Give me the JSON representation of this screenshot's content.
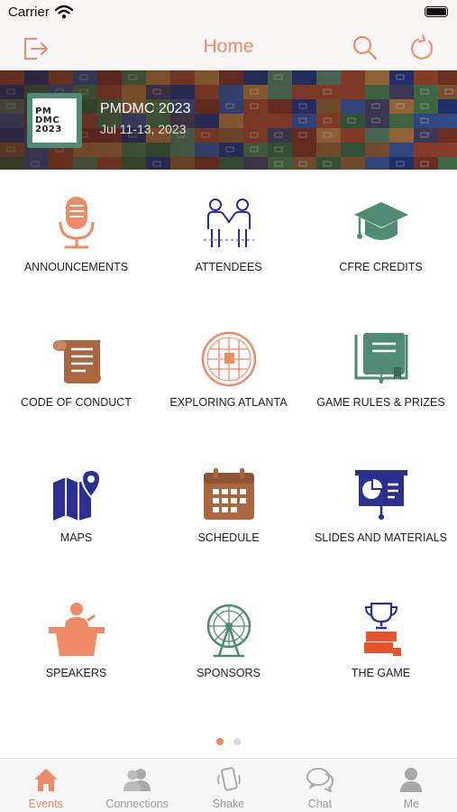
{
  "status_bar": {
    "carrier": "Carrier"
  },
  "nav": {
    "title": "Home"
  },
  "colors": {
    "accent": "#ef8a66",
    "green": "#4f8b72",
    "navy": "#2b2f8f",
    "brown": "#a9663f"
  },
  "banner": {
    "title": "PMDMC 2023",
    "date": "Jul 11-13, 2023",
    "logo_lines": [
      "PM",
      "DMC",
      "2023"
    ]
  },
  "tiles": [
    {
      "label": "ANNOUNCEMENTS",
      "icon": "microphone-icon"
    },
    {
      "label": "ATTENDEES",
      "icon": "handshake-people-icon"
    },
    {
      "label": "CFRE CREDITS",
      "icon": "graduation-cap-icon"
    },
    {
      "label": "CODE OF CONDUCT",
      "icon": "scroll-icon"
    },
    {
      "label": "EXPLORING ATLANTA",
      "icon": "city-map-icon"
    },
    {
      "label": "GAME RULES & PRIZES",
      "icon": "rule-book-icon"
    },
    {
      "label": "MAPS",
      "icon": "map-pin-icon"
    },
    {
      "label": "SCHEDULE",
      "icon": "calendar-icon"
    },
    {
      "label": "SLIDES AND MATERIALS",
      "icon": "presentation-icon"
    },
    {
      "label": "SPEAKERS",
      "icon": "podium-icon"
    },
    {
      "label": "SPONSORS",
      "icon": "ferris-wheel-icon"
    },
    {
      "label": "THE GAME",
      "icon": "trophy-game-icon"
    }
  ],
  "pager": {
    "pages": 2,
    "current": 1
  },
  "tabs": [
    {
      "label": "Events",
      "icon": "home-icon",
      "active": true
    },
    {
      "label": "Connections",
      "icon": "people-icon",
      "active": false
    },
    {
      "label": "Shake",
      "icon": "phone-shake-icon",
      "active": false
    },
    {
      "label": "Chat",
      "icon": "chat-bubble-icon",
      "active": false
    },
    {
      "label": "Me",
      "icon": "person-icon",
      "active": false
    }
  ]
}
